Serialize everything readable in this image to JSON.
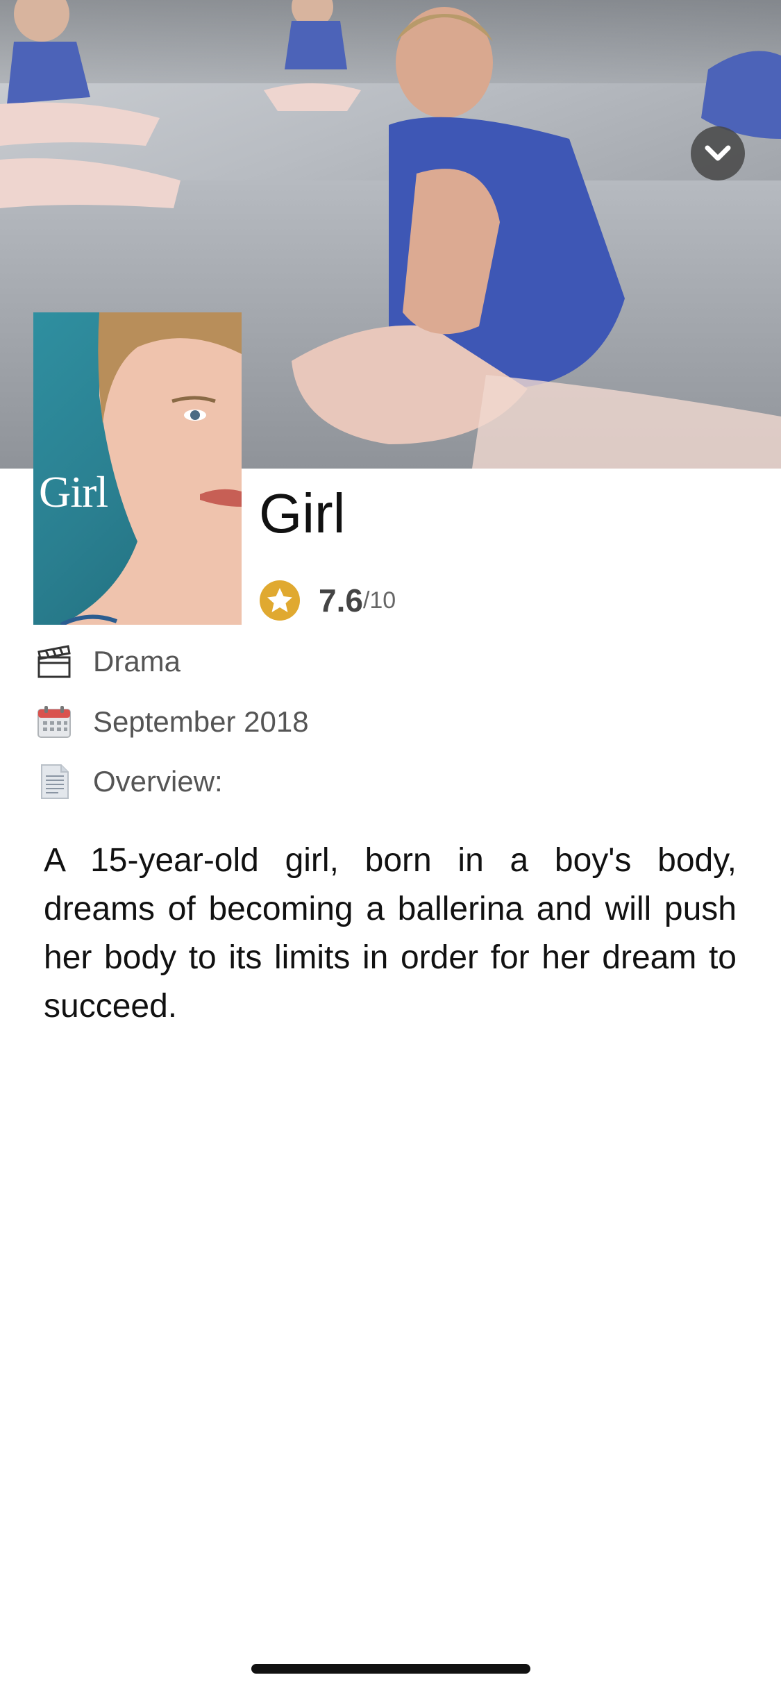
{
  "movie": {
    "title": "Girl",
    "poster_title": "Girl",
    "rating": "7.6",
    "rating_max": "/10",
    "genre": "Drama",
    "release_date": "September 2018",
    "overview_label": "Overview:",
    "overview": "A 15-year-old girl, born in a boy's body, dreams of becoming a ballerina and will push her body to its limits in order for her dream to succeed."
  },
  "icons": {
    "collapse": "chevron-down-icon",
    "rating": "star-icon",
    "genre": "clapperboard-icon",
    "date": "calendar-icon",
    "overview": "document-icon"
  },
  "colors": {
    "star": "#E0A930",
    "calendar_red": "#D9534F",
    "text_primary": "#111111",
    "text_secondary": "#555555"
  }
}
